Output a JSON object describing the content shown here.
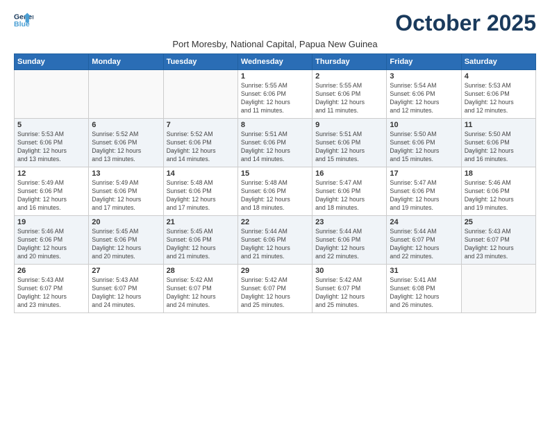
{
  "logo": {
    "line1": "General",
    "line2": "Blue"
  },
  "title": "October 2025",
  "subtitle": "Port Moresby, National Capital, Papua New Guinea",
  "days_header": [
    "Sunday",
    "Monday",
    "Tuesday",
    "Wednesday",
    "Thursday",
    "Friday",
    "Saturday"
  ],
  "weeks": [
    {
      "shaded": false,
      "days": [
        {
          "num": "",
          "info": ""
        },
        {
          "num": "",
          "info": ""
        },
        {
          "num": "",
          "info": ""
        },
        {
          "num": "1",
          "info": "Sunrise: 5:55 AM\nSunset: 6:06 PM\nDaylight: 12 hours\nand 11 minutes."
        },
        {
          "num": "2",
          "info": "Sunrise: 5:55 AM\nSunset: 6:06 PM\nDaylight: 12 hours\nand 11 minutes."
        },
        {
          "num": "3",
          "info": "Sunrise: 5:54 AM\nSunset: 6:06 PM\nDaylight: 12 hours\nand 12 minutes."
        },
        {
          "num": "4",
          "info": "Sunrise: 5:53 AM\nSunset: 6:06 PM\nDaylight: 12 hours\nand 12 minutes."
        }
      ]
    },
    {
      "shaded": true,
      "days": [
        {
          "num": "5",
          "info": "Sunrise: 5:53 AM\nSunset: 6:06 PM\nDaylight: 12 hours\nand 13 minutes."
        },
        {
          "num": "6",
          "info": "Sunrise: 5:52 AM\nSunset: 6:06 PM\nDaylight: 12 hours\nand 13 minutes."
        },
        {
          "num": "7",
          "info": "Sunrise: 5:52 AM\nSunset: 6:06 PM\nDaylight: 12 hours\nand 14 minutes."
        },
        {
          "num": "8",
          "info": "Sunrise: 5:51 AM\nSunset: 6:06 PM\nDaylight: 12 hours\nand 14 minutes."
        },
        {
          "num": "9",
          "info": "Sunrise: 5:51 AM\nSunset: 6:06 PM\nDaylight: 12 hours\nand 15 minutes."
        },
        {
          "num": "10",
          "info": "Sunrise: 5:50 AM\nSunset: 6:06 PM\nDaylight: 12 hours\nand 15 minutes."
        },
        {
          "num": "11",
          "info": "Sunrise: 5:50 AM\nSunset: 6:06 PM\nDaylight: 12 hours\nand 16 minutes."
        }
      ]
    },
    {
      "shaded": false,
      "days": [
        {
          "num": "12",
          "info": "Sunrise: 5:49 AM\nSunset: 6:06 PM\nDaylight: 12 hours\nand 16 minutes."
        },
        {
          "num": "13",
          "info": "Sunrise: 5:49 AM\nSunset: 6:06 PM\nDaylight: 12 hours\nand 17 minutes."
        },
        {
          "num": "14",
          "info": "Sunrise: 5:48 AM\nSunset: 6:06 PM\nDaylight: 12 hours\nand 17 minutes."
        },
        {
          "num": "15",
          "info": "Sunrise: 5:48 AM\nSunset: 6:06 PM\nDaylight: 12 hours\nand 18 minutes."
        },
        {
          "num": "16",
          "info": "Sunrise: 5:47 AM\nSunset: 6:06 PM\nDaylight: 12 hours\nand 18 minutes."
        },
        {
          "num": "17",
          "info": "Sunrise: 5:47 AM\nSunset: 6:06 PM\nDaylight: 12 hours\nand 19 minutes."
        },
        {
          "num": "18",
          "info": "Sunrise: 5:46 AM\nSunset: 6:06 PM\nDaylight: 12 hours\nand 19 minutes."
        }
      ]
    },
    {
      "shaded": true,
      "days": [
        {
          "num": "19",
          "info": "Sunrise: 5:46 AM\nSunset: 6:06 PM\nDaylight: 12 hours\nand 20 minutes."
        },
        {
          "num": "20",
          "info": "Sunrise: 5:45 AM\nSunset: 6:06 PM\nDaylight: 12 hours\nand 20 minutes."
        },
        {
          "num": "21",
          "info": "Sunrise: 5:45 AM\nSunset: 6:06 PM\nDaylight: 12 hours\nand 21 minutes."
        },
        {
          "num": "22",
          "info": "Sunrise: 5:44 AM\nSunset: 6:06 PM\nDaylight: 12 hours\nand 21 minutes."
        },
        {
          "num": "23",
          "info": "Sunrise: 5:44 AM\nSunset: 6:06 PM\nDaylight: 12 hours\nand 22 minutes."
        },
        {
          "num": "24",
          "info": "Sunrise: 5:44 AM\nSunset: 6:07 PM\nDaylight: 12 hours\nand 22 minutes."
        },
        {
          "num": "25",
          "info": "Sunrise: 5:43 AM\nSunset: 6:07 PM\nDaylight: 12 hours\nand 23 minutes."
        }
      ]
    },
    {
      "shaded": false,
      "days": [
        {
          "num": "26",
          "info": "Sunrise: 5:43 AM\nSunset: 6:07 PM\nDaylight: 12 hours\nand 23 minutes."
        },
        {
          "num": "27",
          "info": "Sunrise: 5:43 AM\nSunset: 6:07 PM\nDaylight: 12 hours\nand 24 minutes."
        },
        {
          "num": "28",
          "info": "Sunrise: 5:42 AM\nSunset: 6:07 PM\nDaylight: 12 hours\nand 24 minutes."
        },
        {
          "num": "29",
          "info": "Sunrise: 5:42 AM\nSunset: 6:07 PM\nDaylight: 12 hours\nand 25 minutes."
        },
        {
          "num": "30",
          "info": "Sunrise: 5:42 AM\nSunset: 6:07 PM\nDaylight: 12 hours\nand 25 minutes."
        },
        {
          "num": "31",
          "info": "Sunrise: 5:41 AM\nSunset: 6:08 PM\nDaylight: 12 hours\nand 26 minutes."
        },
        {
          "num": "",
          "info": ""
        }
      ]
    }
  ]
}
